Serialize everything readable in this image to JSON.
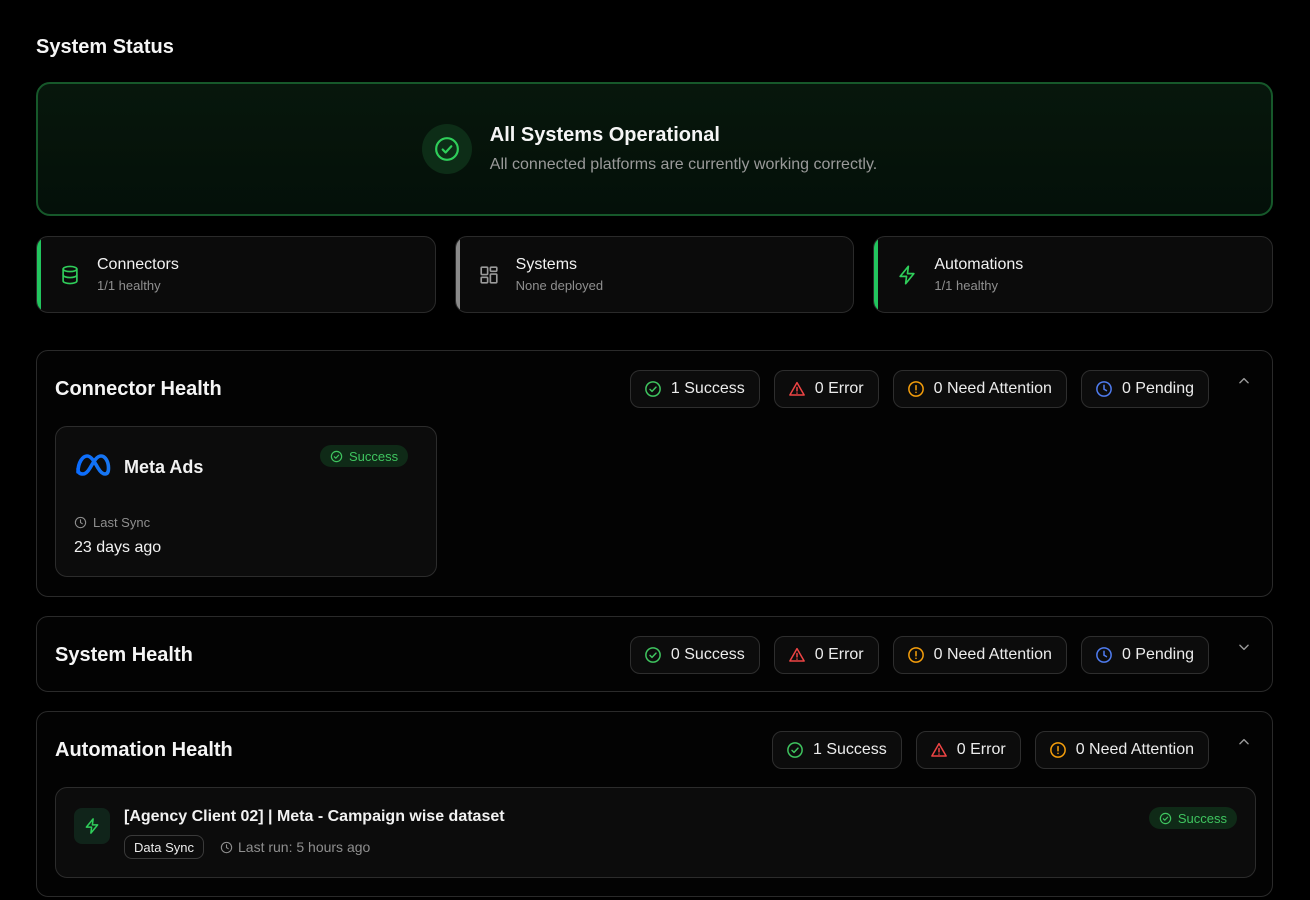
{
  "page": {
    "title": "System Status"
  },
  "banner": {
    "title": "All Systems Operational",
    "subtitle": "All connected platforms are currently working correctly.",
    "icon": "check-circle-icon"
  },
  "summary": [
    {
      "title": "Connectors",
      "subtitle": "1/1 healthy",
      "icon": "database-icon",
      "accent": "#22c55e"
    },
    {
      "title": "Systems",
      "subtitle": "None deployed",
      "icon": "grid-icon",
      "accent": "#8a8a8a"
    },
    {
      "title": "Automations",
      "subtitle": "1/1 healthy",
      "icon": "lightning-icon",
      "accent": "#22c55e"
    }
  ],
  "connector_health": {
    "title": "Connector Health",
    "pills": {
      "success": "1 Success",
      "error": "0 Error",
      "attention": "0 Need Attention",
      "pending": "0 Pending"
    },
    "card": {
      "name": "Meta Ads",
      "badge": "Success",
      "sync_label": "Last Sync",
      "sync_value": "23 days ago"
    }
  },
  "system_health": {
    "title": "System Health",
    "pills": {
      "success": "0 Success",
      "error": "0 Error",
      "attention": "0 Need Attention",
      "pending": "0 Pending"
    }
  },
  "automation_health": {
    "title": "Automation Health",
    "pills": {
      "success": "1 Success",
      "error": "0 Error",
      "attention": "0 Need Attention"
    },
    "item": {
      "title": "[Agency Client 02] | Meta - Campaign wise dataset",
      "tag": "Data Sync",
      "last_run": "Last run: 5 hours ago",
      "badge": "Success"
    }
  },
  "colors": {
    "success": "#3fc45f",
    "error": "#ef4444",
    "attention": "#f59e0b",
    "pending": "#4f7cf0",
    "banner_border": "#16582a"
  }
}
